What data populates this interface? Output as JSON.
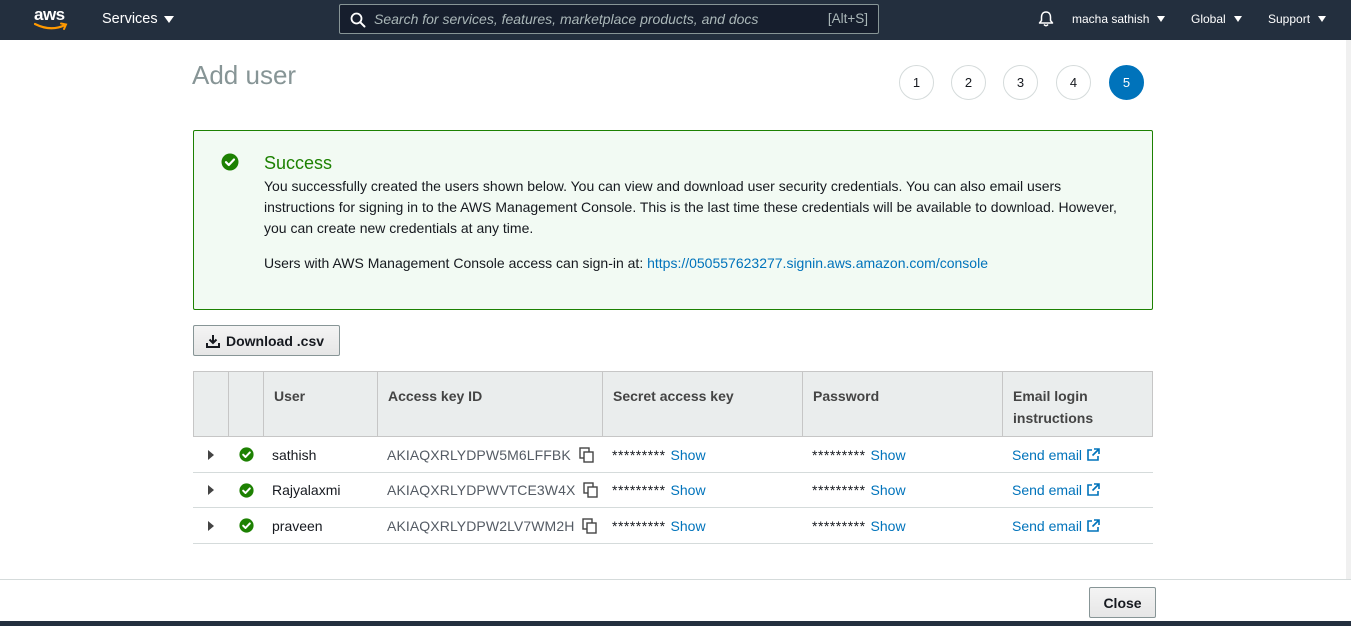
{
  "nav": {
    "logo_text": "aws",
    "services_label": "Services",
    "search_placeholder": "Search for services, features, marketplace products, and docs",
    "search_shortcut": "[Alt+S]",
    "user_label": "macha sathish",
    "region_label": "Global",
    "support_label": "Support"
  },
  "page": {
    "title": "Add user",
    "steps": [
      "1",
      "2",
      "3",
      "4",
      "5"
    ],
    "active_step": 5
  },
  "success": {
    "title": "Success",
    "message": "You successfully created the users shown below. You can view and download user security credentials. You can also email users instructions for signing in to the AWS Management Console. This is the last time these credentials will be available to download. However, you can create new credentials at any time.",
    "signin_text": "Users with AWS Management Console access can sign-in at: ",
    "signin_url": "https://050557623277.signin.aws.amazon.com/console"
  },
  "download_label": "Download .csv",
  "table": {
    "headers": {
      "user": "User",
      "access_key": "Access key ID",
      "secret": "Secret access key",
      "password": "Password",
      "email": "Email login instructions"
    },
    "rows": [
      {
        "user": "sathish",
        "access_key": "AKIAQXRLYDPW5M6LFFBK",
        "secret_mask": "*********",
        "password_mask": "*********",
        "show_label": "Show",
        "email_label": "Send email"
      },
      {
        "user": "Rajyalaxmi",
        "access_key": "AKIAQXRLYDPWVTCE3W4X",
        "secret_mask": "*********",
        "password_mask": "*********",
        "show_label": "Show",
        "email_label": "Send email"
      },
      {
        "user": "praveen",
        "access_key": "AKIAQXRLYDPW2LV7WM2H",
        "secret_mask": "*********",
        "password_mask": "*********",
        "show_label": "Show",
        "email_label": "Send email"
      }
    ]
  },
  "close_label": "Close",
  "colors": {
    "nav_bg": "#232f3e",
    "accent_orange": "#ff9900",
    "success_green": "#1d8102",
    "link_blue": "#0073bb",
    "active_step": "#0073bb"
  }
}
